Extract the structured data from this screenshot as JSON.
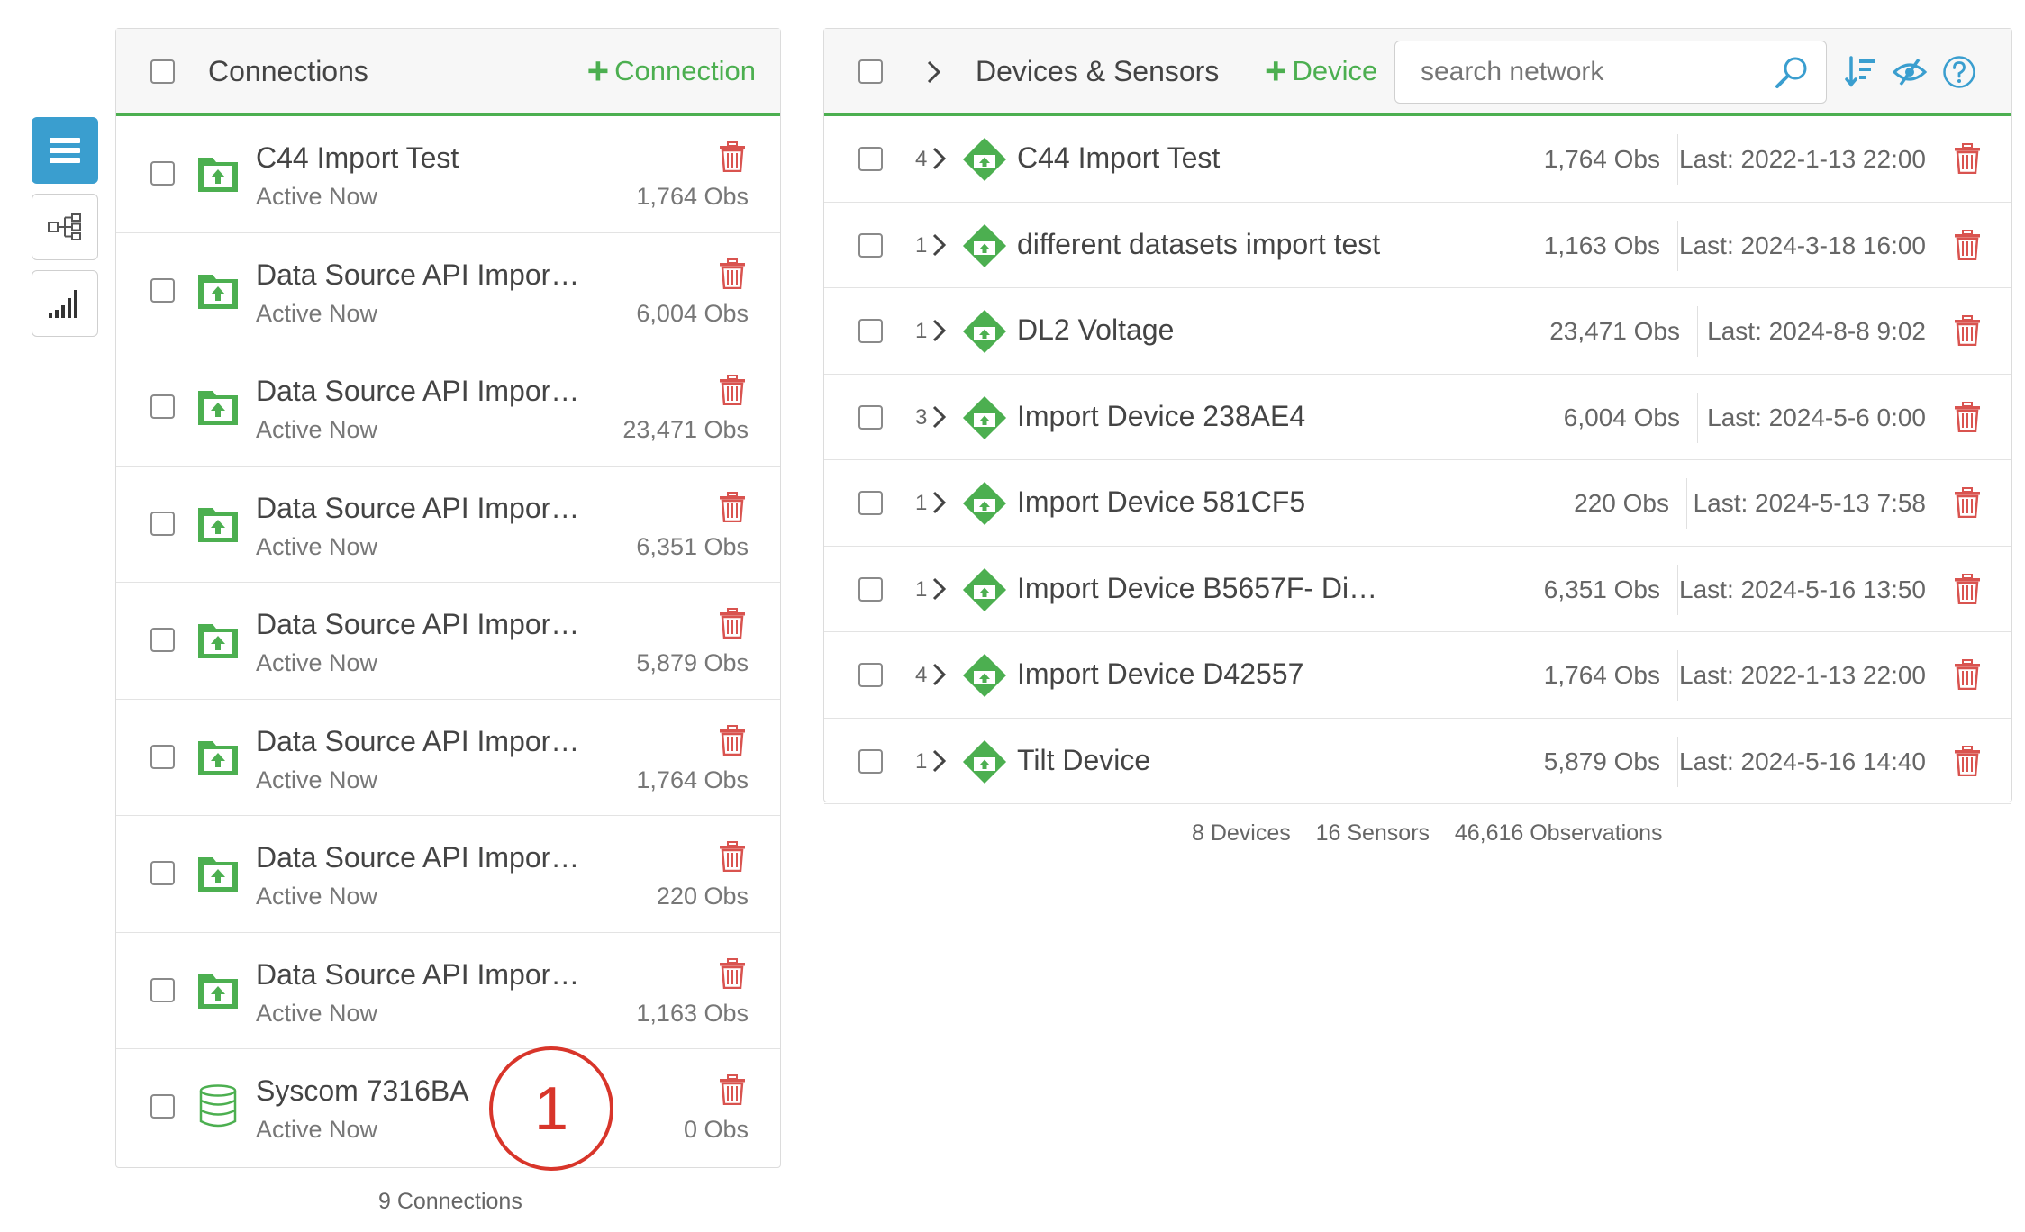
{
  "sidebar": {
    "buttons": [
      "list-icon",
      "network-tree-icon",
      "signal-bars-icon"
    ]
  },
  "connections": {
    "title": "Connections",
    "add_label": "Connection",
    "items": [
      {
        "name": "C44 Import Test",
        "status": "Active Now",
        "obs": "1,764 Obs",
        "icon": "upload-folder-icon"
      },
      {
        "name": "Data Source API Impor…",
        "status": "Active Now",
        "obs": "6,004 Obs",
        "icon": "upload-folder-icon"
      },
      {
        "name": "Data Source API Impor…",
        "status": "Active Now",
        "obs": "23,471 Obs",
        "icon": "upload-folder-icon"
      },
      {
        "name": "Data Source API Impor…",
        "status": "Active Now",
        "obs": "6,351 Obs",
        "icon": "upload-folder-icon"
      },
      {
        "name": "Data Source API Impor…",
        "status": "Active Now",
        "obs": "5,879 Obs",
        "icon": "upload-folder-icon"
      },
      {
        "name": "Data Source API Impor…",
        "status": "Active Now",
        "obs": "1,764 Obs",
        "icon": "upload-folder-icon"
      },
      {
        "name": "Data Source API Impor…",
        "status": "Active Now",
        "obs": "220 Obs",
        "icon": "upload-folder-icon"
      },
      {
        "name": "Data Source API Impor…",
        "status": "Active Now",
        "obs": "1,163 Obs",
        "icon": "upload-folder-icon"
      },
      {
        "name": "Syscom 7316BA",
        "status": "Active Now",
        "obs": "0 Obs",
        "icon": "database-icon"
      }
    ],
    "footer": "9 Connections"
  },
  "devices": {
    "title": "Devices & Sensors",
    "add_label": "Device",
    "search_placeholder": "search network",
    "items": [
      {
        "count": "4",
        "name": "C44 Import Test",
        "obs": "1,764 Obs",
        "last": "Last: 2022-1-13 22:00"
      },
      {
        "count": "1",
        "name": "different datasets import test",
        "obs": "1,163 Obs",
        "last": "Last: 2024-3-18 16:00"
      },
      {
        "count": "1",
        "name": "DL2 Voltage",
        "obs": "23,471 Obs",
        "last": "Last: 2024-8-8 9:02"
      },
      {
        "count": "3",
        "name": "Import Device 238AE4",
        "obs": "6,004 Obs",
        "last": "Last: 2024-5-6 0:00"
      },
      {
        "count": "1",
        "name": "Import Device 581CF5",
        "obs": "220 Obs",
        "last": "Last: 2024-5-13 7:58"
      },
      {
        "count": "1",
        "name": "Import Device B5657F- Di…",
        "obs": "6,351 Obs",
        "last": "Last: 2024-5-16 13:50"
      },
      {
        "count": "4",
        "name": "Import Device D42557",
        "obs": "1,764 Obs",
        "last": "Last: 2022-1-13 22:00"
      },
      {
        "count": "1",
        "name": "Tilt Device",
        "obs": "5,879 Obs",
        "last": "Last: 2024-5-16 14:40"
      }
    ],
    "footer": {
      "devices": "8 Devices",
      "sensors": "16 Sensors",
      "observations": "46,616 Observations"
    }
  },
  "annotation": "1",
  "colors": {
    "accent": "#4caf50",
    "blue": "#3a9ecf",
    "trash": "#d9534f",
    "annotation": "#d8352a"
  }
}
